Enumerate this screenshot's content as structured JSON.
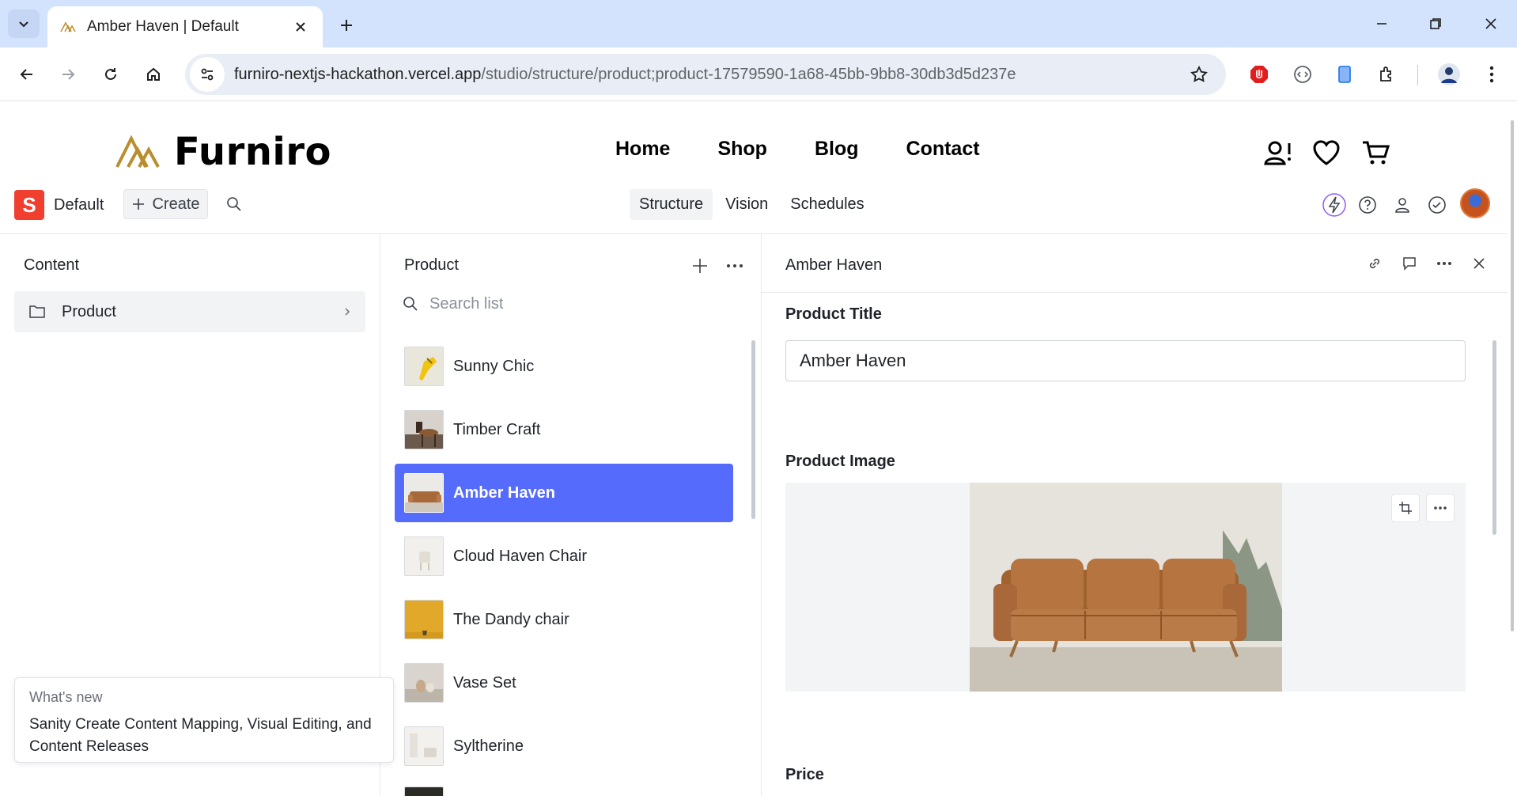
{
  "browser": {
    "tab_title": "Amber Haven | Default",
    "url_host": "furniro-nextjs-hackathon.vercel.app",
    "url_path": "/studio/structure/product;product-17579590-1a68-45bb-9bb8-30db3d5d237e"
  },
  "site": {
    "logo_text": "Furniro",
    "nav": [
      "Home",
      "Shop",
      "Blog",
      "Contact"
    ],
    "logo_color": "#b88e2f"
  },
  "studio": {
    "workspace": "Default",
    "workspace_logo": "S",
    "create_label": "Create",
    "tabs": [
      "Structure",
      "Vision",
      "Schedules"
    ],
    "active_tab": "Structure",
    "accent": "#556bfc",
    "brand_red": "#f03e2f"
  },
  "content_pane": {
    "title": "Content",
    "items": [
      {
        "label": "Product"
      }
    ]
  },
  "list_pane": {
    "title": "Product",
    "search_placeholder": "Search list",
    "items": [
      {
        "name": "Sunny Chic"
      },
      {
        "name": "Timber Craft"
      },
      {
        "name": "Amber Haven",
        "selected": true
      },
      {
        "name": "Cloud Haven Chair"
      },
      {
        "name": "The Dandy chair"
      },
      {
        "name": "Vase Set"
      },
      {
        "name": "Syltherine"
      }
    ]
  },
  "document": {
    "title": "Amber Haven",
    "fields": {
      "title_label": "Product Title",
      "title_value": "Amber Haven",
      "image_label": "Product Image",
      "price_label": "Price"
    }
  },
  "toast": {
    "kicker": "What's new",
    "text": "Sanity Create Content Mapping, Visual Editing, and Content Releases"
  }
}
